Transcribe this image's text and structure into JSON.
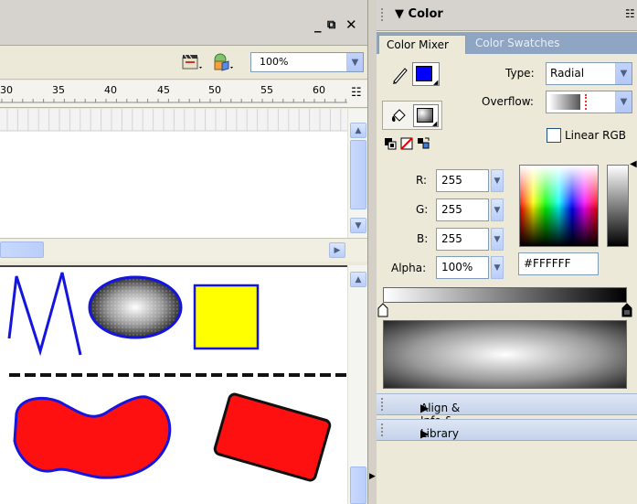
{
  "toolbar": {
    "zoom_value": "100%"
  },
  "timeline": {
    "ruler_labels": [
      "30",
      "35",
      "40",
      "45",
      "50",
      "55",
      "60"
    ]
  },
  "color_panel": {
    "title": "Color",
    "tabs": [
      {
        "label": "Color Mixer",
        "active": true
      },
      {
        "label": "Color Swatches",
        "active": false
      }
    ],
    "type_label": "Type:",
    "type_value": "Radial",
    "overflow_label": "Overflow:",
    "linear_rgb_label": "Linear RGB",
    "linear_rgb_checked": false,
    "stroke_color": "#0000ff",
    "fill_style": "radial-gray",
    "r_label": "R:",
    "r_value": "255",
    "g_label": "G:",
    "g_value": "255",
    "b_label": "B:",
    "b_value": "255",
    "alpha_label": "Alpha:",
    "alpha_value": "100%",
    "hex_value": "#FFFFFF"
  },
  "collapsed_panels": [
    {
      "label": "Align & Info & Transform"
    },
    {
      "label": "Library"
    }
  ],
  "stage_shapes": {
    "zigzag_color": "#1515e0",
    "oval_fill": "radial-gray",
    "square_fill": "#ffff00",
    "blob_fill": "#ff1010",
    "rect_fill": "#ff1010"
  },
  "icons": [
    "restore-window-icon",
    "close-icon",
    "pencil-icon",
    "paint-bucket-icon",
    "black-white-icon",
    "no-color-icon",
    "swap-colors-icon",
    "panel-options-icon",
    "edit-scene-icon",
    "edit-symbol-icon"
  ]
}
